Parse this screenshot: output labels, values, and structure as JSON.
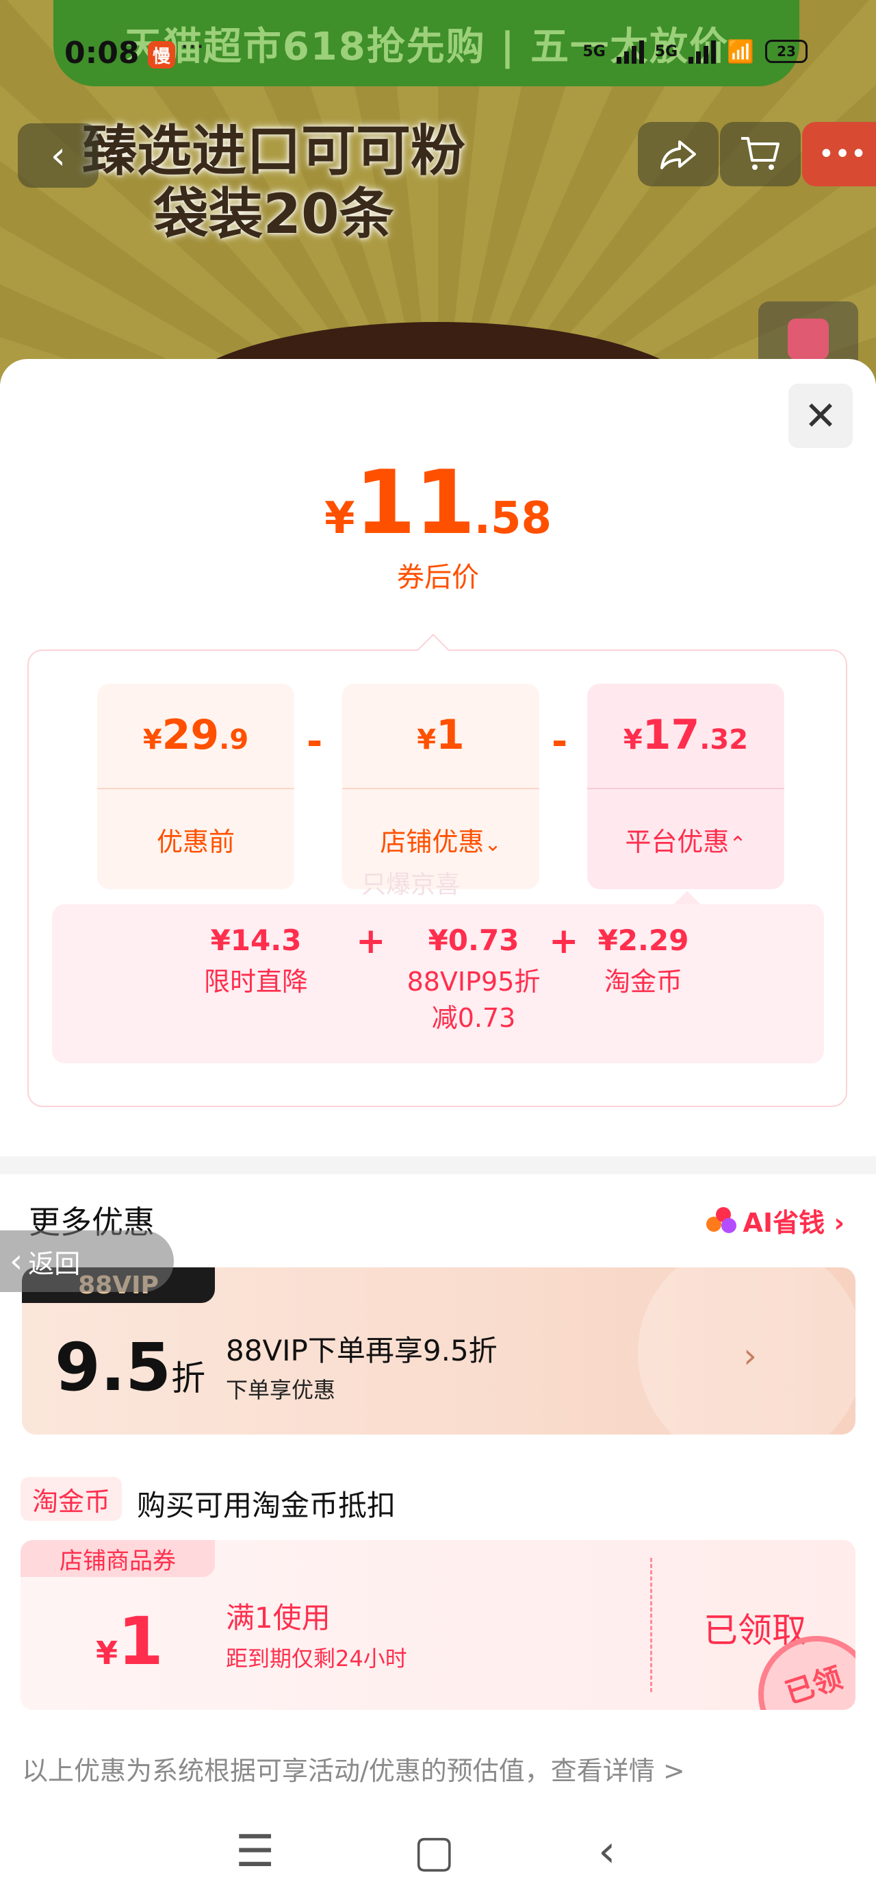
{
  "status_bar": {
    "time": "0:08",
    "app_icon": "慢",
    "dots": "···",
    "net1": "5G",
    "net2": "5G",
    "battery": "23"
  },
  "promo_banner": "天猫超市618抢先购 | 五一大放价",
  "product_title": "臻选进口可可粉\n袋装20条",
  "top_nav": {
    "back_icon": "chevron-left",
    "share_icon": "share",
    "cart_icon": "cart",
    "more_icon": "more"
  },
  "price_sheet": {
    "final_price": {
      "currency": "¥",
      "integer": "11",
      "decimal": ".58",
      "label": "券后价"
    },
    "breakdown": {
      "before": {
        "currency": "¥",
        "integer": "29",
        "decimal": ".9",
        "label": "优惠前"
      },
      "operator1": "-",
      "shop": {
        "currency": "¥",
        "integer": "1",
        "decimal": "",
        "label": "店铺优惠",
        "chevron": "⌄"
      },
      "operator2": "-",
      "platform": {
        "currency": "¥",
        "integer": "17",
        "decimal": ".32",
        "label": "平台优惠",
        "chevron": "⌃"
      }
    },
    "platform_detail": {
      "watermark": "只爆京喜",
      "items": [
        {
          "value": "¥14.3",
          "name": "限时直降"
        },
        {
          "value": "¥0.73",
          "name": "88VIP95折\n减0.73"
        },
        {
          "value": "¥2.29",
          "name": "淘金币"
        }
      ],
      "plus1": "+",
      "plus2": "+"
    }
  },
  "more_offers": {
    "title": "更多优惠",
    "ai_save": "AI省钱 ›",
    "back_chip": "返回",
    "vip_card": {
      "badge": "88VIP",
      "discount": "9.5",
      "unit": "折",
      "main": "88VIP下单再享9.5折",
      "sub": "下单享优惠",
      "arrow": "›"
    },
    "coin": {
      "tag": "淘金币",
      "text": "购买可用淘金币抵扣"
    },
    "coupon": {
      "tag": "店铺商品券",
      "currency": "¥",
      "amount": "1",
      "condition": "满1使用",
      "expiry": "距到期仅剩24小时",
      "status": "已领取",
      "stamp": "已领"
    }
  },
  "disclaimer": "以上优惠为系统根据可享活动/优惠的预估值，查看详情 >",
  "close_icon": "✕",
  "system_nav": {
    "menu": "☰",
    "home": "▢",
    "back": "‹"
  }
}
